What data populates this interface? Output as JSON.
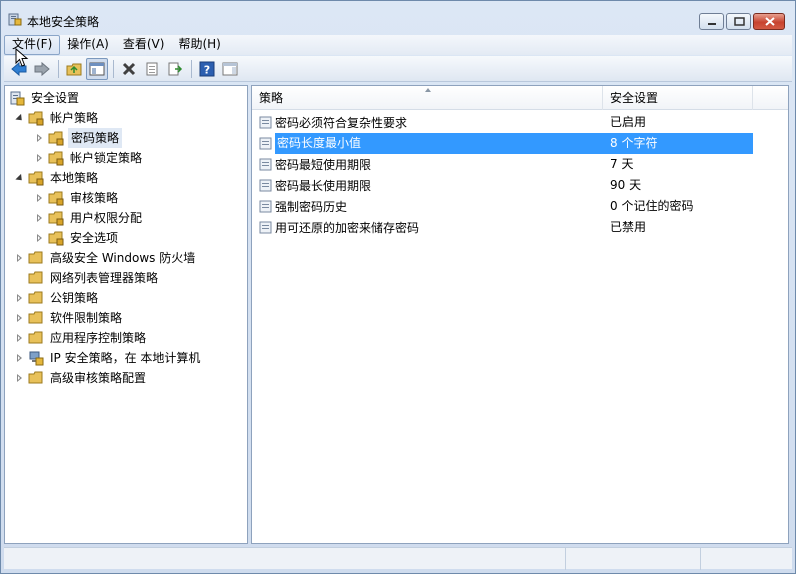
{
  "window": {
    "title": "本地安全策略",
    "minimize_icon": "minimize-icon",
    "maximize_icon": "maximize-icon",
    "close_icon": "close-icon"
  },
  "menubar": {
    "items": [
      {
        "label": "文件(F)"
      },
      {
        "label": "操作(A)"
      },
      {
        "label": "查看(V)"
      },
      {
        "label": "帮助(H)"
      }
    ]
  },
  "toolbar": {
    "icons": [
      "back-arrow-icon",
      "forward-arrow-icon",
      "up-folder-icon",
      "show-hide-tree-icon",
      "delete-icon",
      "properties-icon",
      "export-list-icon",
      "help-icon",
      "console-pane-icon"
    ]
  },
  "tree": {
    "root": "安全设置",
    "nodes": [
      {
        "label": "帐户策略"
      },
      {
        "label": "密码策略"
      },
      {
        "label": "帐户锁定策略"
      },
      {
        "label": "本地策略"
      },
      {
        "label": "审核策略"
      },
      {
        "label": "用户权限分配"
      },
      {
        "label": "安全选项"
      },
      {
        "label": "高级安全 Windows 防火墙"
      },
      {
        "label": "网络列表管理器策略"
      },
      {
        "label": "公钥策略"
      },
      {
        "label": "软件限制策略"
      },
      {
        "label": "应用程序控制策略"
      },
      {
        "label": "IP 安全策略，在 本地计算机"
      },
      {
        "label": "高级审核策略配置"
      }
    ]
  },
  "list": {
    "columns": [
      "策略",
      "安全设置"
    ],
    "rows": [
      {
        "policy": "密码必须符合复杂性要求",
        "setting": "已启用"
      },
      {
        "policy": "密码长度最小值",
        "setting": "8 个字符"
      },
      {
        "policy": "密码最短使用期限",
        "setting": "7 天"
      },
      {
        "policy": "密码最长使用期限",
        "setting": "90 天"
      },
      {
        "policy": "强制密码历史",
        "setting": "0 个记住的密码"
      },
      {
        "policy": "用可还原的加密来储存密码",
        "setting": "已禁用"
      }
    ],
    "selected_index": 1
  },
  "colors": {
    "selection": "#3399ff",
    "tree_selection": "#dfe8f4",
    "folder": "#e8c15a"
  }
}
